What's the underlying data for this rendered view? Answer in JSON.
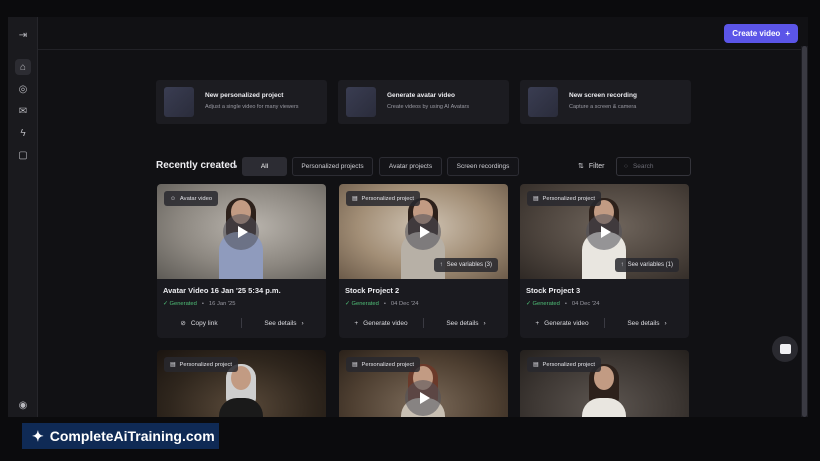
{
  "topbar": {
    "create_label": "Create video",
    "create_icon": "plus-icon"
  },
  "sidebar": {
    "items": [
      {
        "name": "sidebar-collapse",
        "glyph": "⇥"
      },
      {
        "name": "home",
        "glyph": "⌂"
      },
      {
        "name": "explore",
        "glyph": "◎"
      },
      {
        "name": "campaigns",
        "glyph": "✉"
      },
      {
        "name": "integrations",
        "glyph": "ϟ"
      },
      {
        "name": "assets",
        "glyph": "▢"
      }
    ],
    "footer_glyph": "◉"
  },
  "quick_actions": [
    {
      "title": "New personalized project",
      "desc": "Adjust a single video for many viewers"
    },
    {
      "title": "Generate avatar video",
      "desc": "Create videos by using AI Avatars"
    },
    {
      "title": "New screen recording",
      "desc": "Capture a screen & camera"
    }
  ],
  "recent": {
    "title": "Recently created",
    "tabs": [
      "All",
      "Personalized projects",
      "Avatar projects",
      "Screen recordings"
    ],
    "filter_label": "Filter",
    "search_placeholder": "Search"
  },
  "videos": [
    {
      "badge": "Avatar video",
      "title": "Avatar Video 16 Jan '25 5:34 p.m.",
      "status": "Generated",
      "date": "16 Jan '25",
      "actions": [
        "Copy link",
        "See details"
      ],
      "variables": ""
    },
    {
      "badge": "Personalized project",
      "title": "Stock Project 2",
      "status": "Generated",
      "date": "04 Dec '24",
      "actions": [
        "Generate video",
        "See details"
      ],
      "variables": "See variables (3)"
    },
    {
      "badge": "Personalized project",
      "title": "Stock Project 3",
      "status": "Generated",
      "date": "04 Dec '24",
      "actions": [
        "Generate video",
        "See details"
      ],
      "variables": "See variables (1)"
    },
    {
      "badge": "Personalized project"
    },
    {
      "badge": "Personalized project"
    },
    {
      "badge": "Personalized project"
    }
  ],
  "watermark": {
    "text": "CompleteAiTraining.com"
  },
  "colors": {
    "accent": "#5b55e8",
    "success": "#4fbf77"
  }
}
